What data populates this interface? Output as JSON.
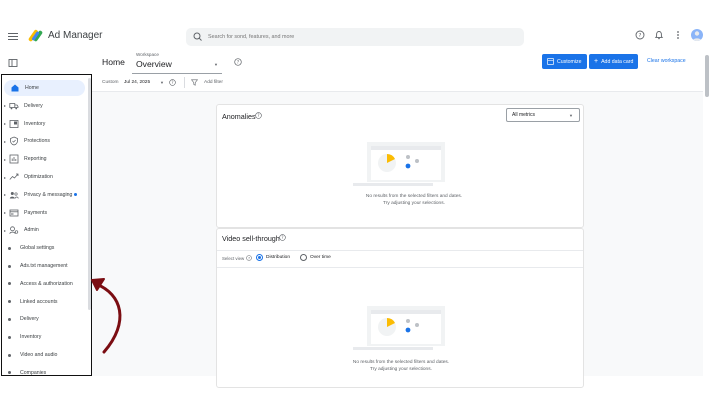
{
  "app": {
    "name": "Ad Manager",
    "search_placeholder": "Search for sond, features, and more"
  },
  "header": {
    "home_label": "Home",
    "workspace_label": "Workspace",
    "workspace_value": "Overview",
    "customize_label": "Customize",
    "add_card_label": "Add data card",
    "clear_label": "Clear workspace"
  },
  "filters": {
    "custom_label": "Custom",
    "date_value": "Jul 24, 2025",
    "add_filter_label": "Add filter"
  },
  "sidebar": {
    "items": [
      {
        "label": "Home",
        "icon": "home-icon",
        "active": true
      },
      {
        "label": "Delivery",
        "icon": "truck-icon",
        "caret": true
      },
      {
        "label": "Inventory",
        "icon": "inventory-icon",
        "caret": true
      },
      {
        "label": "Protections",
        "icon": "shield-icon",
        "caret": true
      },
      {
        "label": "Reporting",
        "icon": "report-icon",
        "caret": true
      },
      {
        "label": "Optimization",
        "icon": "trend-icon",
        "caret": true
      },
      {
        "label": "Privacy & messaging",
        "icon": "people-icon",
        "caret": true,
        "badge": true
      },
      {
        "label": "Payments",
        "icon": "payments-icon",
        "caret": true
      },
      {
        "label": "Admin",
        "icon": "admin-icon",
        "caret": true
      },
      {
        "label": "Global settings"
      },
      {
        "label": "Ads.txt management"
      },
      {
        "label": "Access & authorization"
      },
      {
        "label": "Linked accounts"
      },
      {
        "label": "Delivery"
      },
      {
        "label": "Inventory"
      },
      {
        "label": "Video and audio"
      },
      {
        "label": "Companies"
      }
    ]
  },
  "cards": {
    "anomalies": {
      "title": "Anomalies",
      "metric_select": "All metrics",
      "empty_line1": "No results from the selected filters and dates.",
      "empty_line2": "Try adjusting your selections."
    },
    "video": {
      "title": "Video sell-through",
      "select_view_label": "Select view",
      "option_distribution": "Distribution",
      "option_over_time": "Over time",
      "selected": "Distribution",
      "empty_line1": "No results from the selected filters and dates.",
      "empty_line2": "Try adjusting your selections."
    }
  },
  "colors": {
    "accent": "#1a73e8",
    "active_nav": "#e8f0fe",
    "arrow": "#7b0d12",
    "illus_yellow": "#fbbc04"
  }
}
